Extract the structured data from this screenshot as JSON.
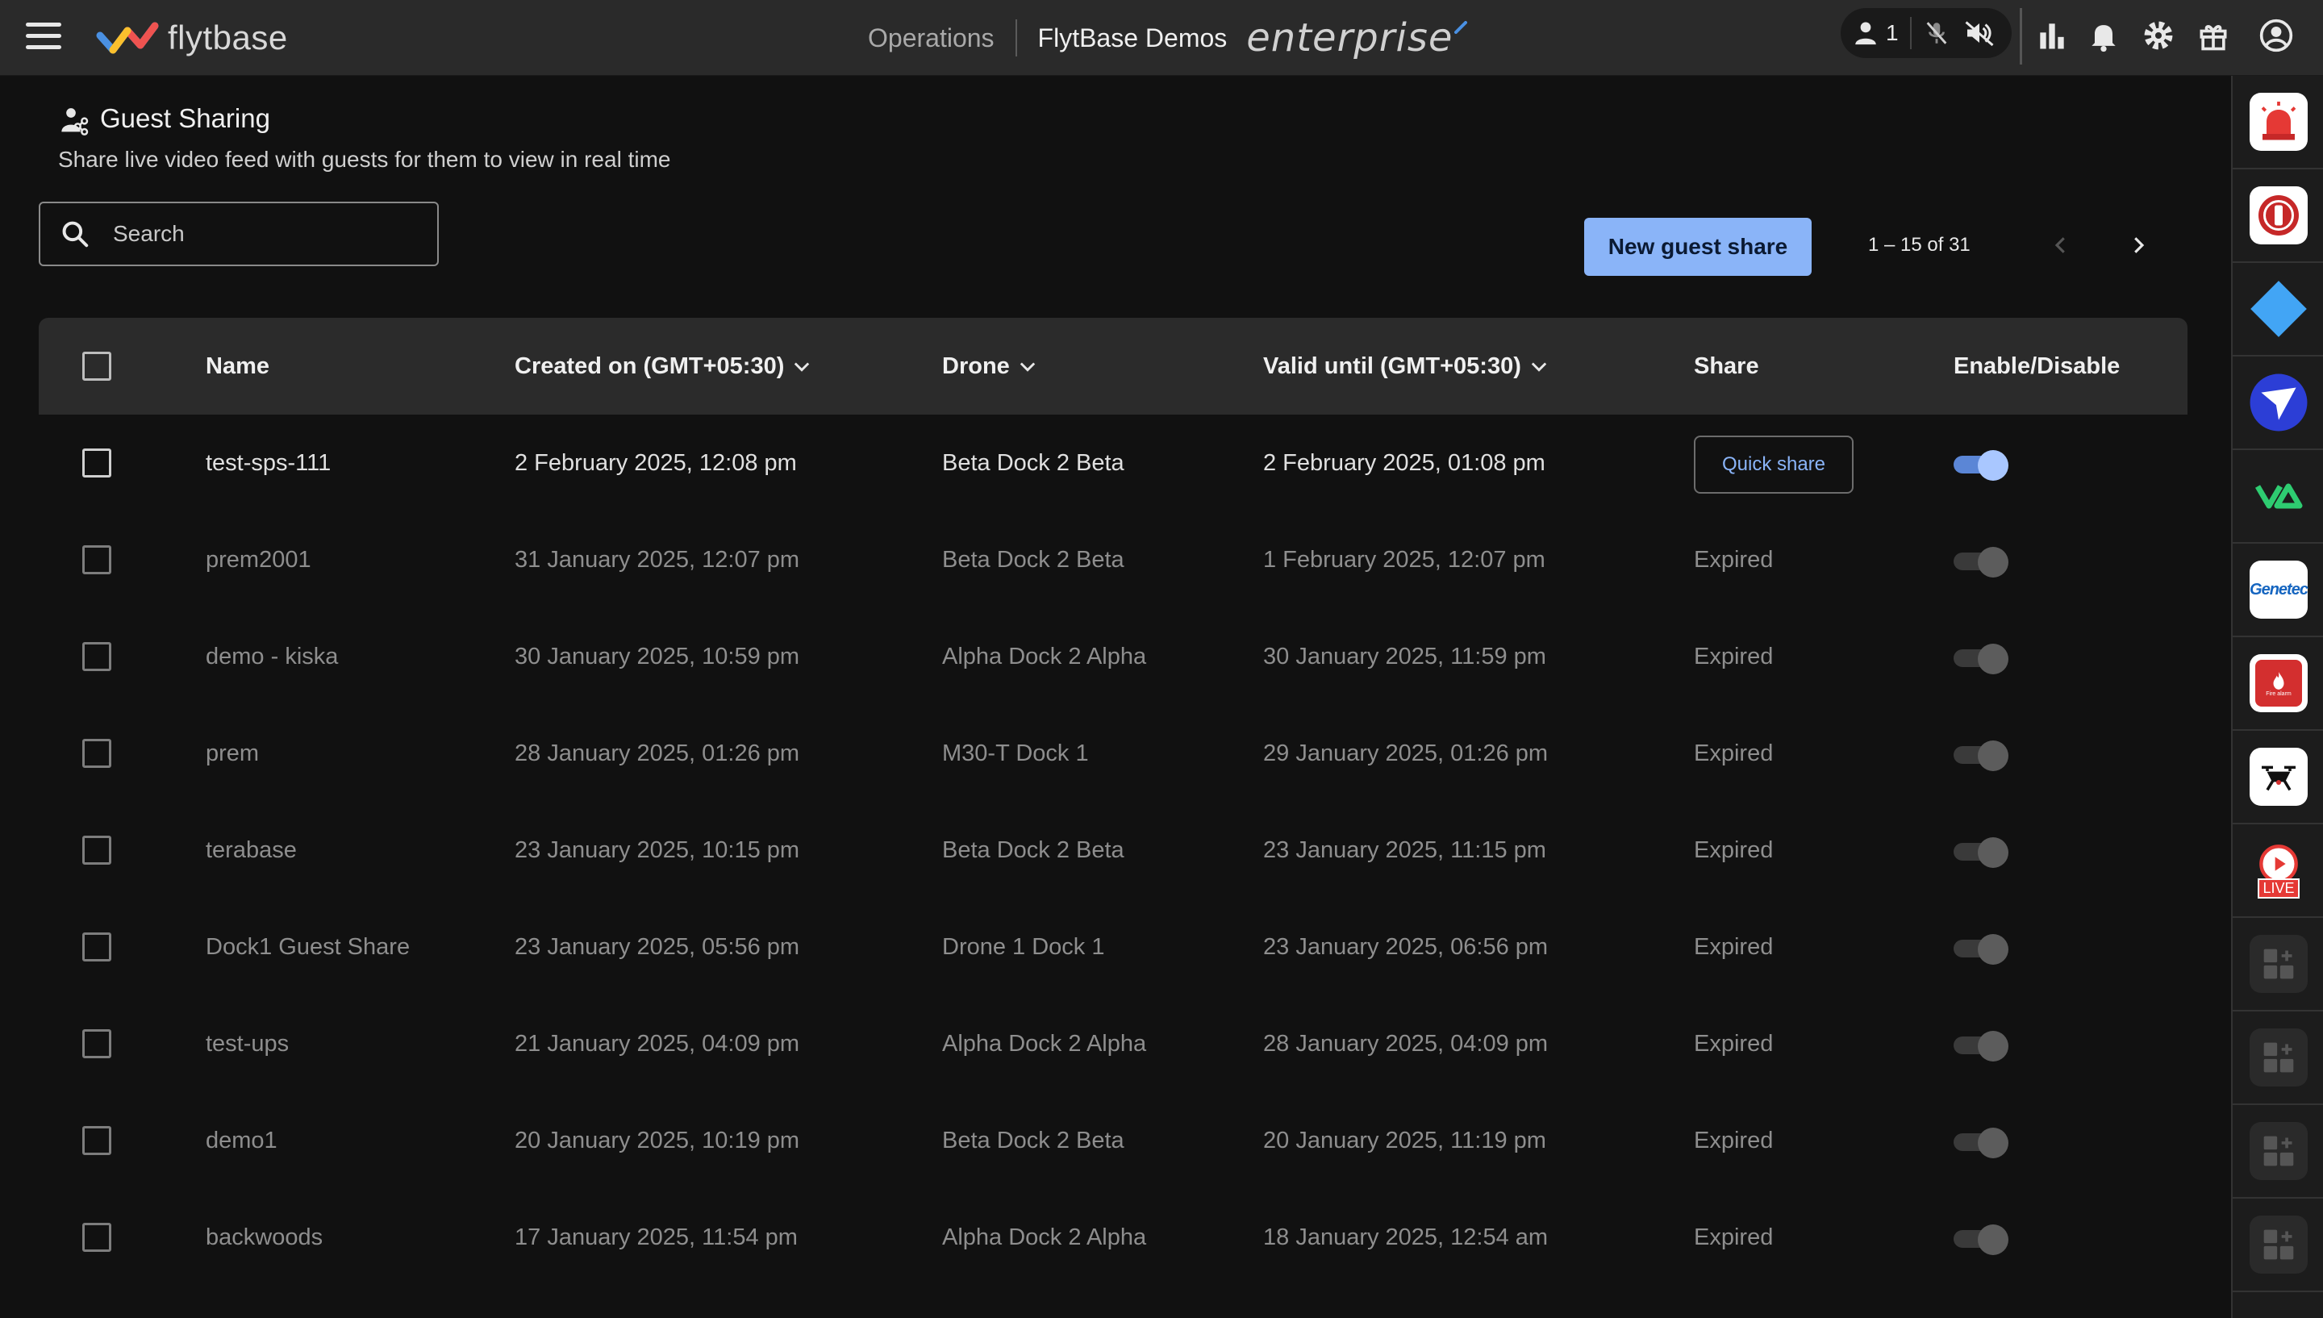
{
  "topbar": {
    "logo_text": "flytbase",
    "nav_operations": "Operations",
    "org_name": "FlytBase Demos",
    "plan": "enterprise",
    "user_count": "1"
  },
  "page": {
    "title": "Guest Sharing",
    "subtitle": "Share live video feed with guests for them to view in real time"
  },
  "search": {
    "placeholder": "Search"
  },
  "new_share_label": "New guest share",
  "pagination": {
    "text": "1 – 15 of 31"
  },
  "table": {
    "headers": {
      "name": "Name",
      "created": "Created on (GMT+05:30)",
      "drone": "Drone",
      "valid": "Valid until (GMT+05:30)",
      "share": "Share",
      "enable": "Enable/Disable"
    },
    "rows": [
      {
        "name": "test-sps-111",
        "created": "2 February 2025, 12:08 pm",
        "drone": "Beta Dock 2 Beta",
        "valid": "2 February 2025, 01:08 pm",
        "share": "Quick share",
        "enabled": true
      },
      {
        "name": "prem2001",
        "created": "31 January 2025, 12:07 pm",
        "drone": "Beta Dock 2 Beta",
        "valid": "1 February 2025, 12:07 pm",
        "share": "Expired",
        "enabled": false
      },
      {
        "name": "demo - kiska",
        "created": "30 January 2025, 10:59 pm",
        "drone": "Alpha Dock 2 Alpha",
        "valid": "30 January 2025, 11:59 pm",
        "share": "Expired",
        "enabled": false
      },
      {
        "name": "prem",
        "created": "28 January 2025, 01:26 pm",
        "drone": "M30-T Dock 1",
        "valid": "29 January 2025, 01:26 pm",
        "share": "Expired",
        "enabled": false
      },
      {
        "name": "terabase",
        "created": "23 January 2025, 10:15 pm",
        "drone": "Beta Dock 2 Beta",
        "valid": "23 January 2025, 11:15 pm",
        "share": "Expired",
        "enabled": false
      },
      {
        "name": "Dock1 Guest Share",
        "created": "23 January 2025, 05:56 pm",
        "drone": "Drone 1 Dock 1",
        "valid": "23 January 2025, 06:56 pm",
        "share": "Expired",
        "enabled": false
      },
      {
        "name": "test-ups",
        "created": "21 January 2025, 04:09 pm",
        "drone": "Alpha Dock 2 Alpha",
        "valid": "28 January 2025, 04:09 pm",
        "share": "Expired",
        "enabled": false
      },
      {
        "name": "demo1",
        "created": "20 January 2025, 10:19 pm",
        "drone": "Beta Dock 2 Beta",
        "valid": "20 January 2025, 11:19 pm",
        "share": "Expired",
        "enabled": false
      },
      {
        "name": "backwoods",
        "created": "17 January 2025, 11:54 pm",
        "drone": "Alpha Dock 2 Alpha",
        "valid": "18 January 2025, 12:54 am",
        "share": "Expired",
        "enabled": false
      }
    ]
  },
  "rail": {
    "live_label": "LIVE",
    "genetec_label": "Genetec",
    "fire_label": "Fire alarm",
    "items": [
      "siren-app",
      "traffic-light-app",
      "diamond-app",
      "paper-plane-app",
      "va-app",
      "genetec-app",
      "fire-alarm-app",
      "drone-app",
      "live-app",
      "add-app",
      "add-app",
      "add-app",
      "add-app"
    ]
  },
  "colors": {
    "accent": "#8ab4f8",
    "topbar": "#2a2a2a",
    "background": "#111111",
    "header_row": "#2b2b2b"
  }
}
